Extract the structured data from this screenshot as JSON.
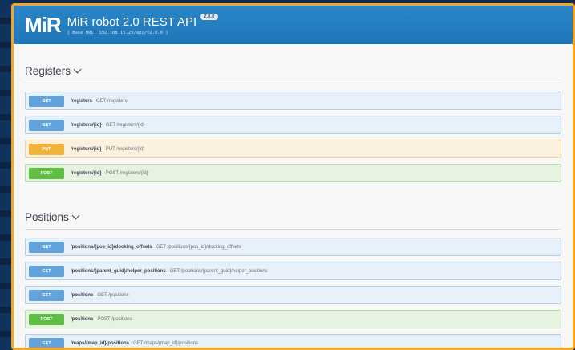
{
  "header": {
    "logo": "MiR",
    "title": "MiR robot 2.0 REST API",
    "version": "2.0.0",
    "base_url": "[ Base URL: 192.168.15.29/api/v2.0.0 ]"
  },
  "colors": {
    "frame": "#f5a623",
    "header": "#2a86c8",
    "get": "#61a3da",
    "put": "#f2b33d",
    "post": "#5fbf45"
  },
  "sections": [
    {
      "title": "Registers",
      "ops": [
        {
          "method": "GET",
          "path": "/registers",
          "desc": "GET /registers"
        },
        {
          "method": "GET",
          "path": "/registers/{id}",
          "desc": "GET /registers/{id}"
        },
        {
          "method": "PUT",
          "path": "/registers/{id}",
          "desc": "PUT /registers/{id}"
        },
        {
          "method": "POST",
          "path": "/registers/{id}",
          "desc": "POST /registers/{id}"
        }
      ]
    },
    {
      "title": "Positions",
      "ops": [
        {
          "method": "GET",
          "path": "/positions/{pos_id}/docking_offsets",
          "desc": "GET /positions/{pos_id}/docking_offsets"
        },
        {
          "method": "GET",
          "path": "/positions/{parent_guid}/helper_positions",
          "desc": "GET /positions/{parent_guid}/helper_positions"
        },
        {
          "method": "GET",
          "path": "/positions",
          "desc": "GET /positions"
        },
        {
          "method": "POST",
          "path": "/positions",
          "desc": "POST /positions"
        },
        {
          "method": "GET",
          "path": "/maps/{map_id}/positions",
          "desc": "GET /maps/{map_id}/positions"
        }
      ]
    }
  ]
}
